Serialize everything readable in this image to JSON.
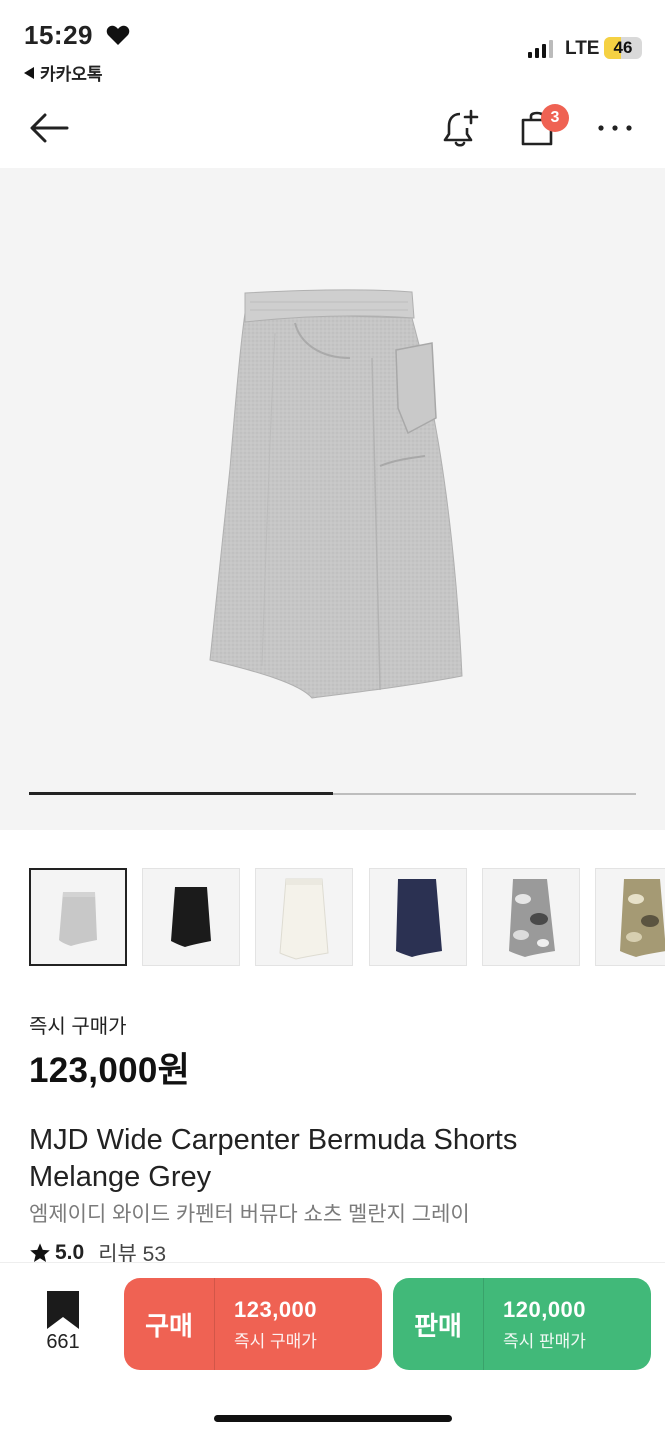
{
  "status_bar": {
    "time": "15:29",
    "back_app": "카카오톡",
    "network": "LTE",
    "battery": "46"
  },
  "nav": {
    "cart_badge": "3"
  },
  "gallery": {
    "progress_fraction": 0.5,
    "thumbnails": [
      {
        "color": "grey",
        "selected": true
      },
      {
        "color": "black",
        "selected": false
      },
      {
        "color": "ivory",
        "selected": false
      },
      {
        "color": "navy",
        "selected": false
      },
      {
        "color": "grey-camo",
        "selected": false
      },
      {
        "color": "khaki-camo",
        "selected": false
      }
    ]
  },
  "product": {
    "price_label": "즉시 구매가",
    "price": "123,000원",
    "title_line1": "MJD Wide Carpenter Bermuda Shorts",
    "title_line2": "Melange Grey",
    "title_ko": "엠제이디 와이드 카펜터 버뮤다 쇼츠 멜란지 그레이",
    "rating": "5.0",
    "review_text": "리뷰 53"
  },
  "bottom_bar": {
    "bookmark_count": "661",
    "buy": {
      "label": "구매",
      "amount": "123,000",
      "sub": "즉시 구매가"
    },
    "sell": {
      "label": "판매",
      "amount": "120,000",
      "sub": "즉시 판매가"
    }
  },
  "colors": {
    "buy": "#ef6253",
    "sell": "#41b979",
    "badge": "#ef6253"
  }
}
